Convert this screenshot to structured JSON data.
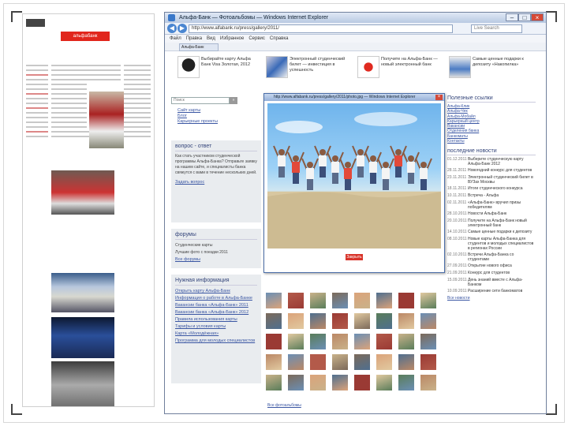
{
  "browser": {
    "title": "Альфа-Банк — Фотоальбомы — Windows Internet Explorer",
    "url": "http://www.alfabank.ru/press/gallery/2011/",
    "search_placeholder": "Live Search",
    "menu": [
      "Файл",
      "Правка",
      "Вид",
      "Избранное",
      "Сервис",
      "Справка"
    ],
    "favorite": "Альфа-Банк",
    "win_min": "–",
    "win_max": "□",
    "win_close": "×"
  },
  "thumb": {
    "banner": "альфабанк"
  },
  "banner": [
    {
      "text": "Выбирайте карту Альфа Банк Visa Золотая, 2012"
    },
    {
      "text": "Электронный студенческий билет — инвестиция в успешность"
    },
    {
      "text": "Получите на Альфа-Банк — новый электронный банк"
    },
    {
      "text": "Самые ценные подарки к депозиту «Накопилка»"
    }
  ],
  "sidebar": {
    "search_placeholder": "Поиск",
    "search_go": "»",
    "links": [
      "Сайт карты",
      "Блог",
      "Карьерные проекты"
    ],
    "qa": {
      "title": "вопрос - ответ",
      "text": "Как стать участником студенческой программы Альфа-Банка? Отправьте заявку на нашем сайте, и специалисты банка свяжутся с вами в течение нескольких дней.",
      "link": "Задать вопрос"
    },
    "forums": {
      "title": "форумы",
      "items": [
        "Студенческие карты",
        "Лучшие фото с поездки 2011"
      ],
      "link": "Все форумы"
    },
    "useful": {
      "title": "Нужная информация",
      "items": [
        "Открыть карту Альфа-Банк",
        "Информация о работе в Альфа-Банке",
        "Вакансии банка «Альфа-Банк» 2011",
        "Вакансии банка «Альфа-Банк» 2012",
        "Правила использования карты",
        "Тарифы и условия карты",
        "Карта «Молодёжная»",
        "Программа для молодых специалистов"
      ]
    }
  },
  "right": {
    "links_title": "Полезные ссылки",
    "links": [
      "Альфа-Клик",
      "Альфа-Чек",
      "Альфа-Мобайл",
      "Карьерный центр",
      "Вакансии",
      "Отделения банка",
      "Банкоматы",
      "Контакты"
    ],
    "news_title": "последние новости",
    "news": [
      {
        "date": "01.12.2011",
        "text": "Выберите студенческую карту Альфа-Банк 2012"
      },
      {
        "date": "28.11.2011",
        "text": "Новогодний конкурс для студентов"
      },
      {
        "date": "23.11.2011",
        "text": "Электронный студенческий билет в ВУЗах Москвы"
      },
      {
        "date": "18.11.2011",
        "text": "Итоги студенческого конкурса"
      },
      {
        "date": "10.11.2011",
        "text": "Встреча - Альфа"
      },
      {
        "date": "02.11.2011",
        "text": "«Альфа-Банк» вручил призы победителям"
      },
      {
        "date": "28.10.2011",
        "text": "Новости Альфа-Банк"
      },
      {
        "date": "20.10.2011",
        "text": "Получите на Альфа-Банк новый электронный банк"
      },
      {
        "date": "14.10.2011",
        "text": "Самые ценные подарки к депозиту"
      },
      {
        "date": "08.10.2011",
        "text": "Новые карты Альфа-Банка для студентов и молодых специалистов в регионах России"
      },
      {
        "date": "02.10.2011",
        "text": "Встречи Альфа-Банка со студентами"
      },
      {
        "date": "27.09.2011",
        "text": "Открытие нового офиса"
      },
      {
        "date": "21.09.2011",
        "text": "Конкурс для студентов"
      },
      {
        "date": "15.09.2011",
        "text": "День знаний вместе с Альфа-Банком"
      },
      {
        "date": "10.09.2011",
        "text": "Расширение сети банкоматов"
      }
    ],
    "news_link": "Все новости"
  },
  "gallery": {
    "more_link": "Все фотоальбомы"
  },
  "popup": {
    "title": "http://www.alfabank.ru/press/gallery/2011/photo.jpg — Windows Internet Explorer",
    "close": "×",
    "button": "Закрыть"
  }
}
